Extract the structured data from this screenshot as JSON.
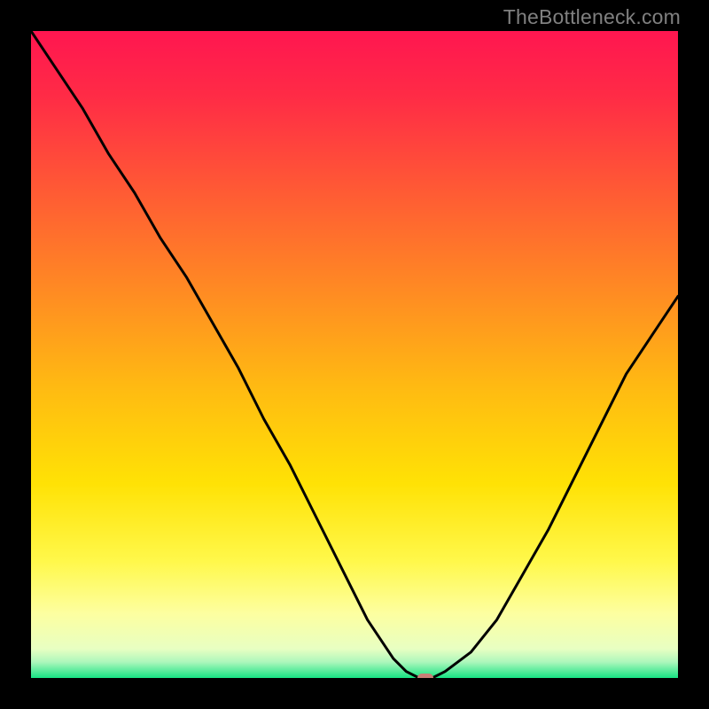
{
  "watermark": "TheBottleneck.com",
  "colors": {
    "frame": "#000000",
    "curve": "#000000",
    "marker": "#c97f77",
    "watermark": "#808080",
    "gradient_stops": [
      {
        "pos": 0.0,
        "color": "#ff1650"
      },
      {
        "pos": 0.1,
        "color": "#ff2b46"
      },
      {
        "pos": 0.25,
        "color": "#ff5b34"
      },
      {
        "pos": 0.4,
        "color": "#ff8a23"
      },
      {
        "pos": 0.55,
        "color": "#ffba12"
      },
      {
        "pos": 0.7,
        "color": "#ffe205"
      },
      {
        "pos": 0.82,
        "color": "#fff84b"
      },
      {
        "pos": 0.9,
        "color": "#fdffa0"
      },
      {
        "pos": 0.955,
        "color": "#e8ffc2"
      },
      {
        "pos": 0.975,
        "color": "#aef7bc"
      },
      {
        "pos": 1.0,
        "color": "#17e383"
      }
    ]
  },
  "chart_data": {
    "type": "line",
    "title": "",
    "xlabel": "",
    "ylabel": "",
    "xlim": [
      0,
      100
    ],
    "ylim": [
      0,
      100
    ],
    "grid": false,
    "series": [
      {
        "name": "bottleneck-curve",
        "x": [
          0,
          4,
          8,
          12,
          16,
          20,
          24,
          28,
          32,
          36,
          40,
          44,
          48,
          52,
          54,
          56,
          58,
          60,
          62,
          64,
          68,
          72,
          76,
          80,
          84,
          88,
          92,
          96,
          100
        ],
        "values": [
          100,
          94,
          88,
          81,
          75,
          68,
          62,
          55,
          48,
          40,
          33,
          25,
          17,
          9,
          6,
          3,
          1,
          0,
          0,
          1,
          4,
          9,
          16,
          23,
          31,
          39,
          47,
          53,
          59
        ]
      }
    ],
    "annotations": [
      {
        "name": "optimal-marker",
        "x": 61,
        "y": 0
      }
    ]
  }
}
